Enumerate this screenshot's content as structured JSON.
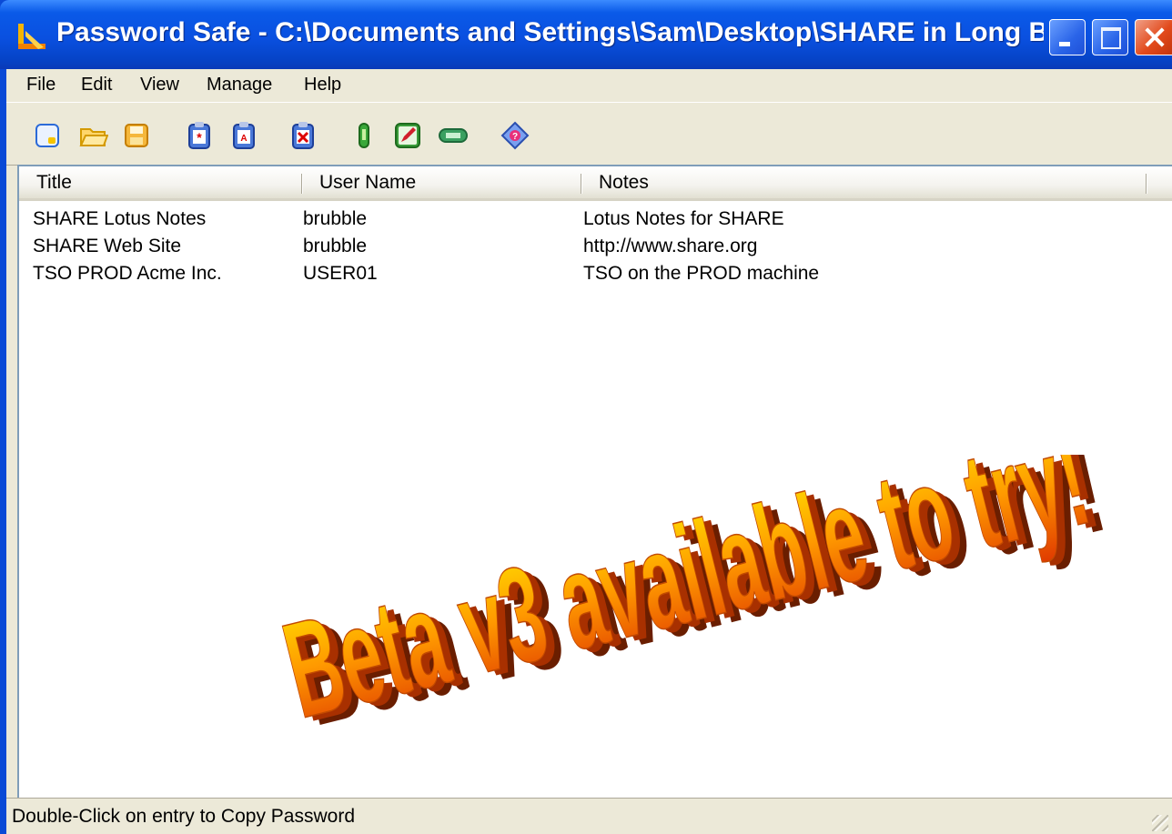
{
  "window": {
    "title": "Password Safe - C:\\Documents and Settings\\Sam\\Desktop\\SHARE in Long Beach\\...",
    "accent_color": "#0a50e0",
    "caption_buttons": [
      "minimize-icon",
      "maximize-icon",
      "close-icon"
    ]
  },
  "menu": {
    "items": [
      "File",
      "Edit",
      "View",
      "Manage",
      "Help"
    ]
  },
  "toolbar": {
    "buttons": [
      {
        "name": "new-database",
        "icon": "new-file-icon"
      },
      {
        "name": "open-database",
        "icon": "open-folder-icon"
      },
      {
        "name": "save-database",
        "icon": "save-icon"
      },
      {
        "name": "copy-password",
        "icon": "copy-password-icon"
      },
      {
        "name": "copy-username",
        "icon": "copy-username-icon"
      },
      {
        "name": "clear-clipboard",
        "icon": "clear-clipboard-icon"
      },
      {
        "name": "add-entry",
        "icon": "add-entry-icon"
      },
      {
        "name": "edit-entry",
        "icon": "edit-entry-icon"
      },
      {
        "name": "delete-entry",
        "icon": "delete-entry-icon"
      },
      {
        "name": "help",
        "icon": "help-icon"
      }
    ]
  },
  "list": {
    "columns": [
      "Title",
      "User Name",
      "Notes"
    ],
    "rows": [
      {
        "title": "SHARE Lotus Notes",
        "user": "brubble",
        "notes": "Lotus Notes for SHARE"
      },
      {
        "title": "SHARE Web Site",
        "user": "brubble",
        "notes": "http://www.share.org"
      },
      {
        "title": "TSO PROD Acme Inc.",
        "user": "USER01",
        "notes": "TSO on the PROD machine"
      }
    ]
  },
  "overlay": {
    "text": "Beta v3 available to try!",
    "colors": [
      "#ffe600",
      "#ff9900",
      "#e03a00"
    ]
  },
  "status": {
    "text": "Double-Click on entry to Copy Password"
  }
}
